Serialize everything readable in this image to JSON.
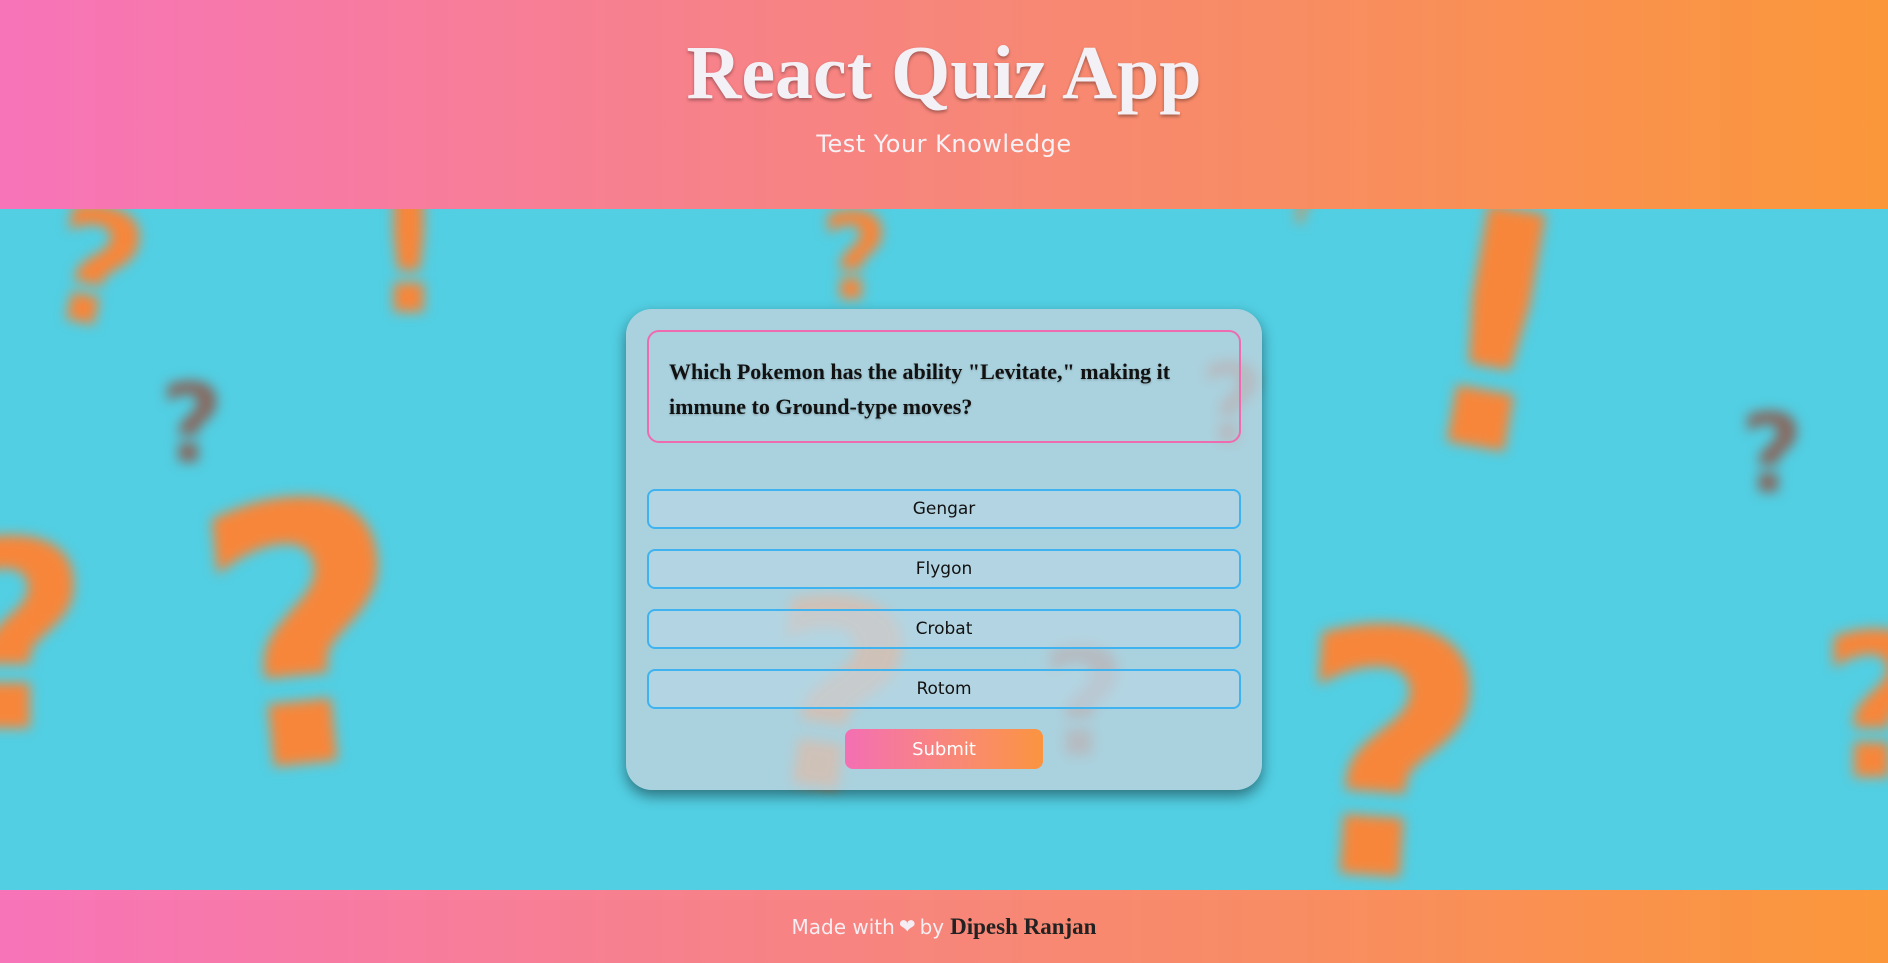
{
  "header": {
    "title": "React Quiz App",
    "subtitle": "Test Your Knowledge"
  },
  "quiz": {
    "question": "Which Pokemon has the ability \"Levitate,\" making it immune to Ground-type moves?",
    "options": [
      "Gengar",
      "Flygon",
      "Crobat",
      "Rotom"
    ],
    "submit_label": "Submit"
  },
  "footer": {
    "made_with": "Made with",
    "heart_icon": "heart-icon",
    "by": "by",
    "author": "Dipesh Ranjan"
  },
  "colors": {
    "gradient_start": "#f774b9",
    "gradient_end": "#fb973a",
    "background": "#52cfe3",
    "accent_orange": "#f7863a",
    "option_border": "#3fb3f0",
    "question_border": "#ee6bb0"
  }
}
